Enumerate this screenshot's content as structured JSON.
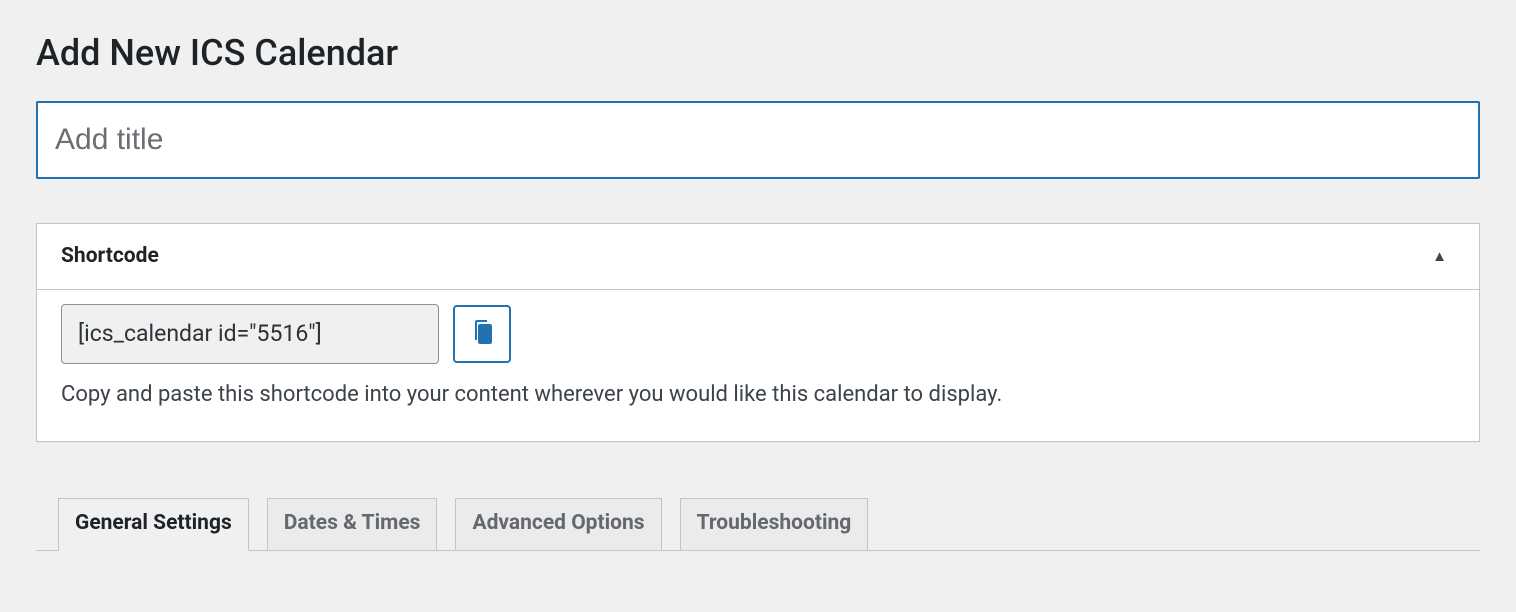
{
  "header": {
    "title": "Add New ICS Calendar"
  },
  "title_field": {
    "placeholder": "Add title",
    "value": ""
  },
  "shortcode": {
    "panel_title": "Shortcode",
    "value": "[ics_calendar id=\"5516\"]",
    "copy_icon": "copy-icon",
    "help": "Copy and paste this shortcode into your content wherever you would like this calendar to display."
  },
  "tabs": [
    {
      "label": "General Settings",
      "active": true
    },
    {
      "label": "Dates & Times",
      "active": false
    },
    {
      "label": "Advanced Options",
      "active": false
    },
    {
      "label": "Troubleshooting",
      "active": false
    }
  ]
}
